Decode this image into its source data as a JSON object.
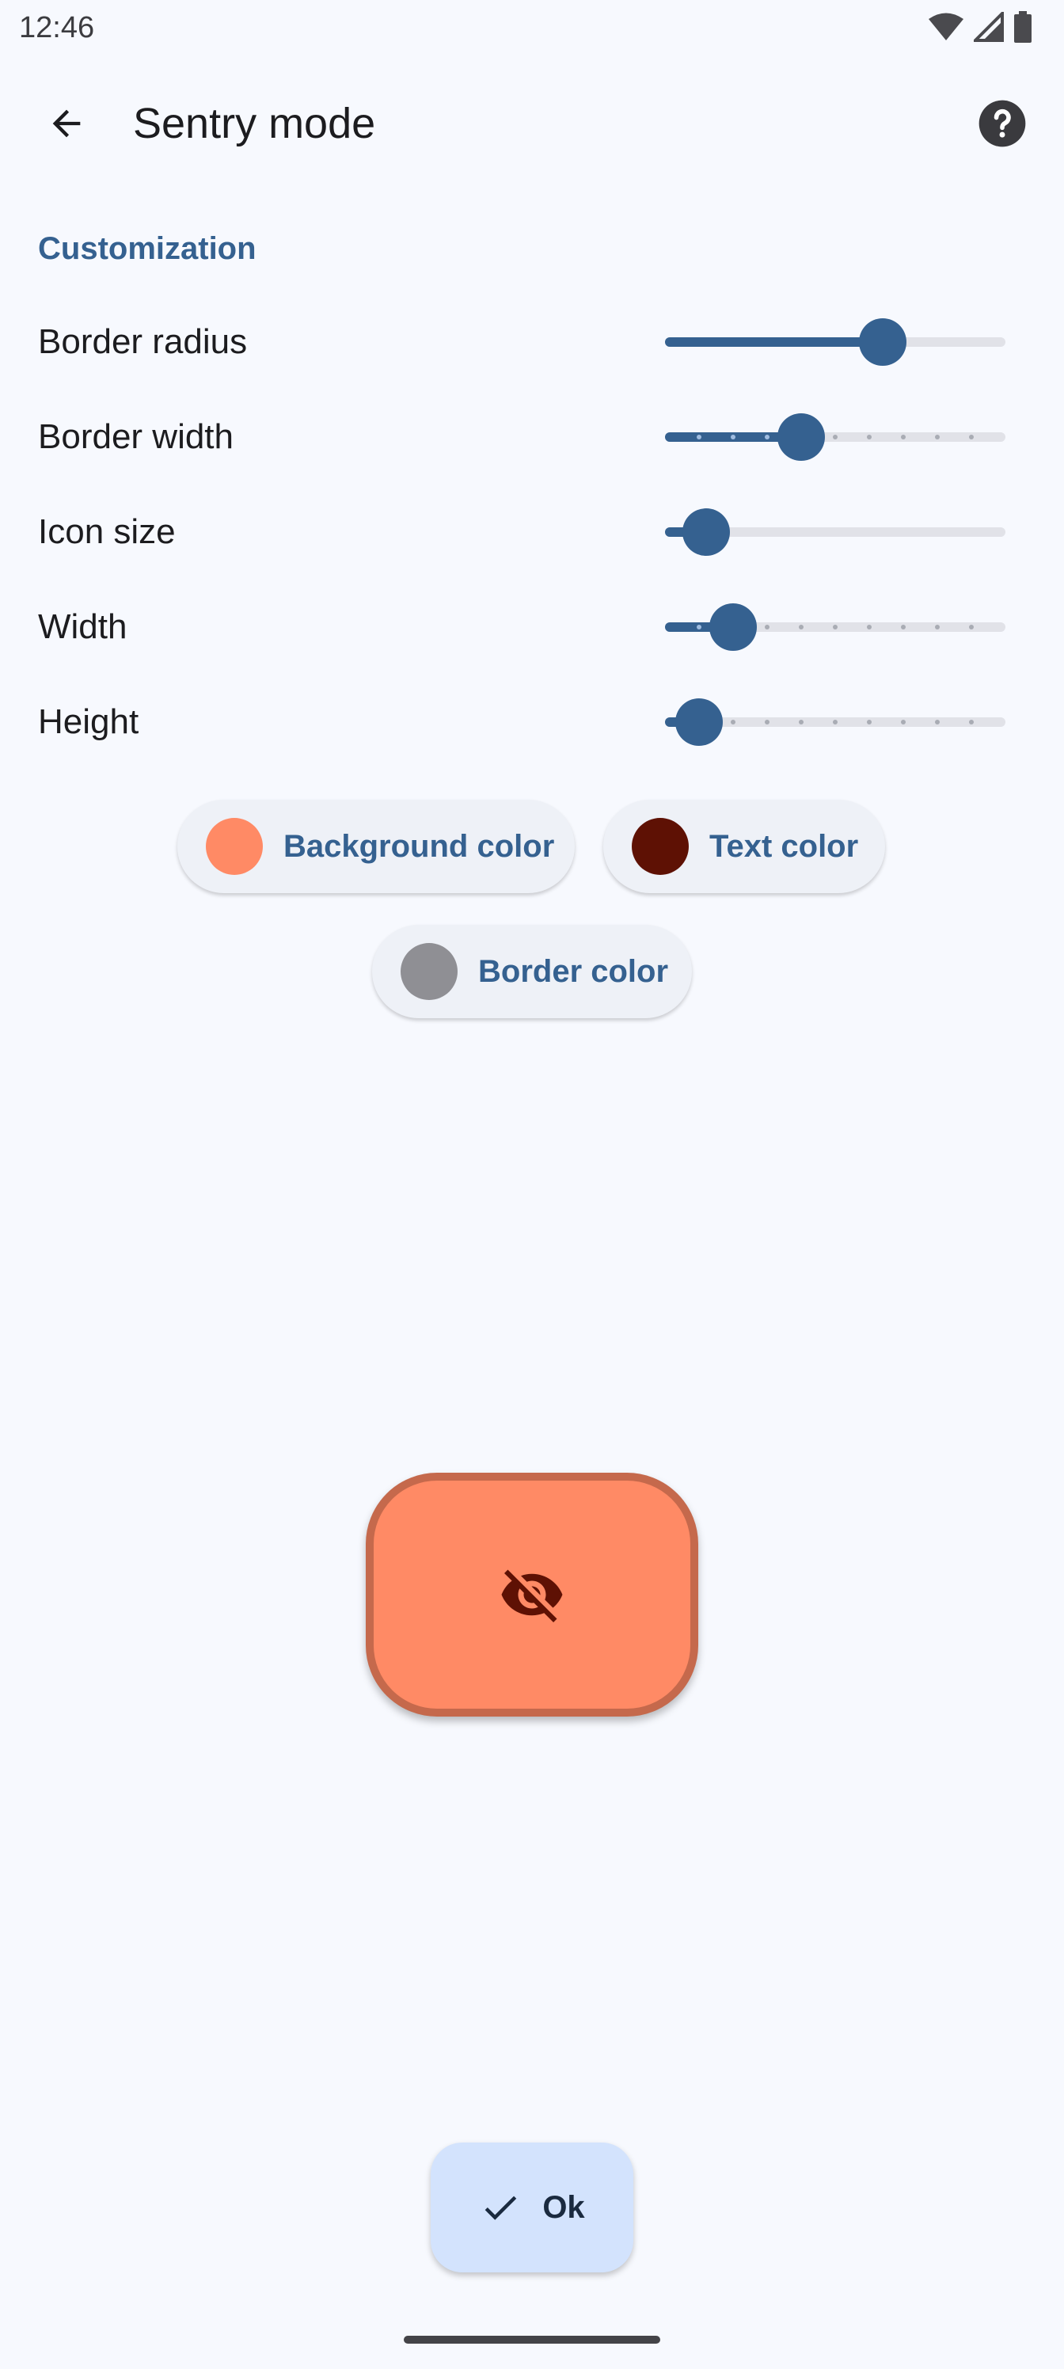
{
  "status_bar": {
    "time": "12:46",
    "icons": [
      "wifi-icon",
      "cellular-signal-icon",
      "battery-icon"
    ]
  },
  "app_bar": {
    "title": "Sentry mode",
    "back_icon": "arrow-back-icon",
    "help_icon": "help-circle-icon"
  },
  "section": {
    "title": "Customization"
  },
  "settings": [
    {
      "label": "Border radius",
      "value_fraction": 0.64,
      "discrete": false,
      "steps": 0
    },
    {
      "label": "Border width",
      "value_fraction": 0.4,
      "discrete": true,
      "steps": 10
    },
    {
      "label": "Icon size",
      "value_fraction": 0.12,
      "discrete": false,
      "steps": 0
    },
    {
      "label": "Width",
      "value_fraction": 0.2,
      "discrete": true,
      "steps": 10
    },
    {
      "label": "Height",
      "value_fraction": 0.1,
      "discrete": true,
      "steps": 10
    }
  ],
  "color_chips": {
    "background": {
      "label": "Background color",
      "color": "#ff8a65"
    },
    "text": {
      "label": "Text color",
      "color": "#5e1104"
    },
    "border": {
      "label": "Border color",
      "color": "#8f8f94"
    }
  },
  "preview": {
    "background": "#ff8a65",
    "border_color": "#c5694c",
    "icon": "visibility-off-icon",
    "icon_color": "#5e1104"
  },
  "ok_button": {
    "label": "Ok",
    "icon": "check-icon"
  },
  "colors": {
    "accent": "#356190",
    "surface": "#f7f9fe",
    "fab": "#d3e3fd"
  }
}
